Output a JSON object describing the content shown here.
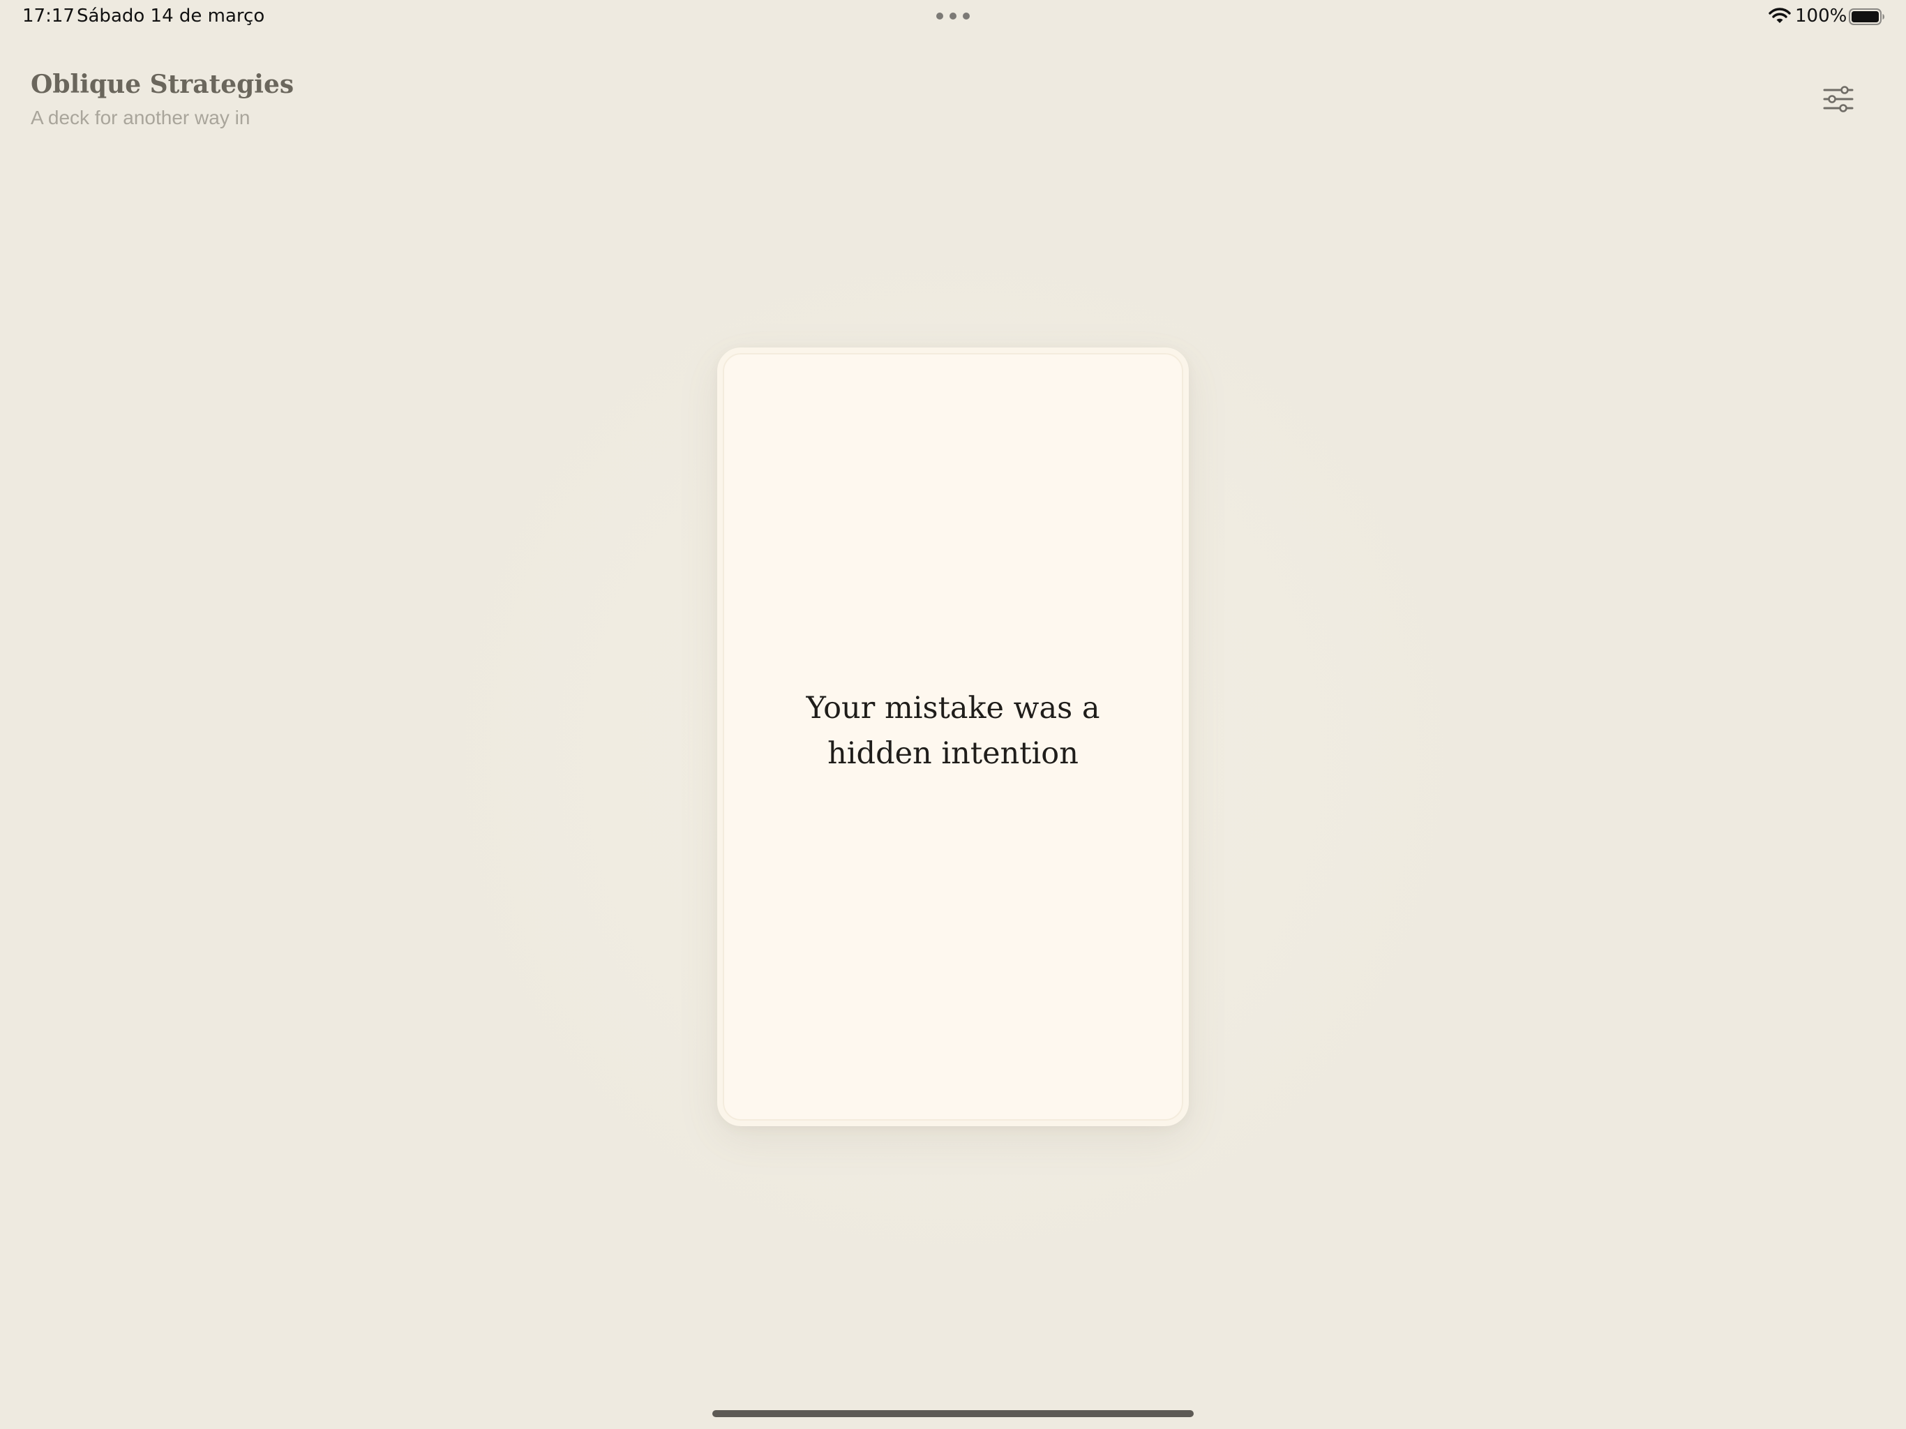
{
  "status_bar": {
    "time": "17:17",
    "date": "Sábado 14 de março",
    "battery_percent": "100%",
    "icons": [
      "wifi-icon",
      "battery-icon",
      "multitask-dots-icon"
    ]
  },
  "header": {
    "title": "Oblique Strategies",
    "subtitle": "A deck for another way in",
    "settings_icon": "sliders-icon"
  },
  "card": {
    "text": "Your mistake was a hidden intention"
  },
  "colors": {
    "background": "#EEEAE0",
    "card": "#FEF8EF",
    "title": "#6A665C",
    "subtitle": "#A9A59B",
    "card_text": "#1F1D1A"
  }
}
